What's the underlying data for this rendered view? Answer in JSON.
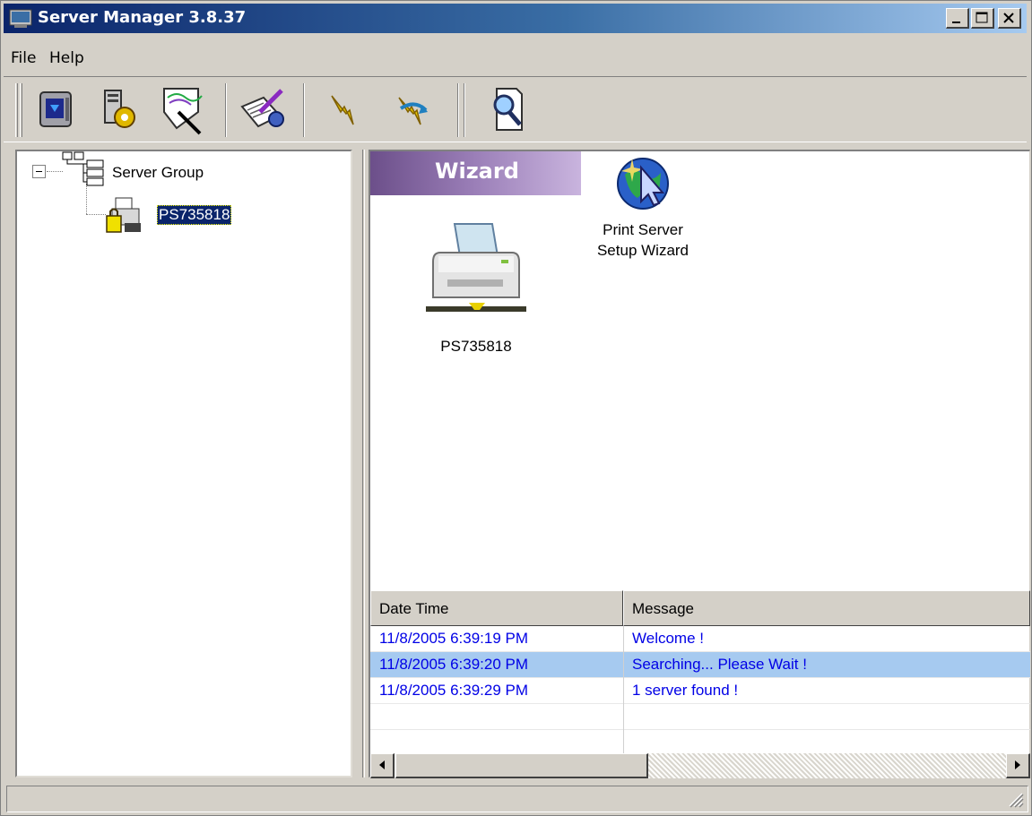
{
  "window": {
    "title": "Server Manager 3.8.37"
  },
  "menu": {
    "file": "File",
    "help": "Help"
  },
  "toolbar": {
    "buttons": [
      {
        "icon": "monitor-icon"
      },
      {
        "icon": "server-config-icon"
      },
      {
        "icon": "wizard-wand-icon"
      },
      {
        "icon": "notepad-edit-icon"
      },
      {
        "icon": "lightning-icon"
      },
      {
        "icon": "disconnect-icon"
      },
      {
        "icon": "search-document-icon"
      }
    ]
  },
  "tree": {
    "root": {
      "label": "Server Group",
      "icon": "server-group-icon"
    },
    "child": {
      "label": "PS735818",
      "icon": "print-server-icon"
    }
  },
  "wizard": {
    "banner": "Wizard",
    "items": [
      {
        "label": "PS735818",
        "icon": "printer-icon"
      },
      {
        "label_line1": "Print Server",
        "label_line2": "Setup Wizard",
        "icon": "globe-cursor-icon"
      }
    ]
  },
  "log": {
    "columns": [
      "Date Time",
      "Message"
    ],
    "rows": [
      {
        "time": "11/8/2005 6:39:19 PM",
        "message": "Welcome !"
      },
      {
        "time": "11/8/2005 6:39:20 PM",
        "message": "Searching... Please Wait !",
        "highlighted": true
      },
      {
        "time": "11/8/2005 6:39:29 PM",
        "message": "1 server found !"
      }
    ]
  },
  "colors": {
    "title_gradient_start": "#0a246a",
    "selection": "#0a246a",
    "log_text": "#0000e6",
    "row_highlight": "#a6caf0"
  }
}
